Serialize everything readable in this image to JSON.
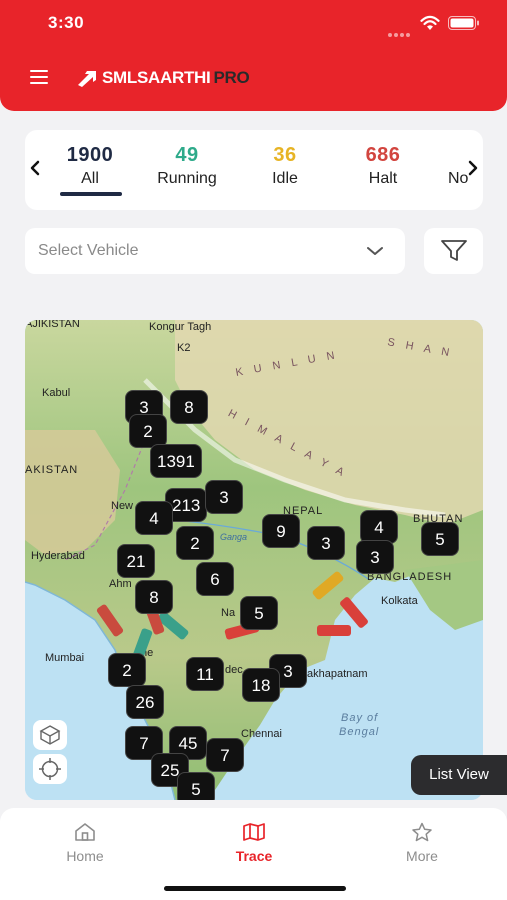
{
  "status_bar": {
    "time": "3:30"
  },
  "app": {
    "name": "SMLSAARTHI",
    "name_suffix": "PRO"
  },
  "status_tabs": [
    {
      "count": "1900",
      "label": "All",
      "color": "#1f2a44",
      "active": true
    },
    {
      "count": "49",
      "label": "Running",
      "color": "#2eaa8a"
    },
    {
      "count": "36",
      "label": "Idle",
      "color": "#e7b425"
    },
    {
      "count": "686",
      "label": "Halt",
      "color": "#d2453f"
    },
    {
      "count": "",
      "label": "No",
      "color": "#1f2a44"
    }
  ],
  "vehicle_select": {
    "placeholder": "Select Vehicle"
  },
  "map": {
    "labels": {
      "tajikistan": "AJIKISTAN",
      "kongur": "Kongur Tagh",
      "kunlun": "K U N L U N",
      "shan": "S H A N",
      "k2": "K2",
      "kabul": "Kabul",
      "pakistan": "AKISTAN",
      "himalaya": "H I M A L A Y A",
      "nepal": "NEPAL",
      "bhutan": "BHUTAN",
      "new_delhi": "New",
      "ganga": "Ganga",
      "hyderabad": "Hyderabad",
      "ahmedabad": "Ahm",
      "bangladesh": "BANGLADESH",
      "kolkata": "Kolkata",
      "nagpur": "Na",
      "mumbai": "Mumbai",
      "pune": "ne",
      "deccan": "dec",
      "visakhapatnam": "akhapatnam",
      "bay_of": "Bay of",
      "bengal": "Bengal",
      "chennai": "Chennai"
    },
    "clusters": [
      "3",
      "8",
      "2",
      "1391",
      "213",
      "3",
      "4",
      "2",
      "9",
      "3",
      "4",
      "3",
      "5",
      "21",
      "6",
      "8",
      "5",
      "2",
      "11",
      "3",
      "18",
      "26",
      "7",
      "45",
      "7",
      "25",
      "5"
    ]
  },
  "list_view_label": "List View",
  "bottom_tabs": [
    {
      "label": "Home",
      "icon": "home-icon"
    },
    {
      "label": "Trace",
      "icon": "map-icon",
      "active": true
    },
    {
      "label": "More",
      "icon": "star-icon"
    }
  ],
  "colors": {
    "brand_red": "#e8242a",
    "navy": "#1f2a44"
  }
}
